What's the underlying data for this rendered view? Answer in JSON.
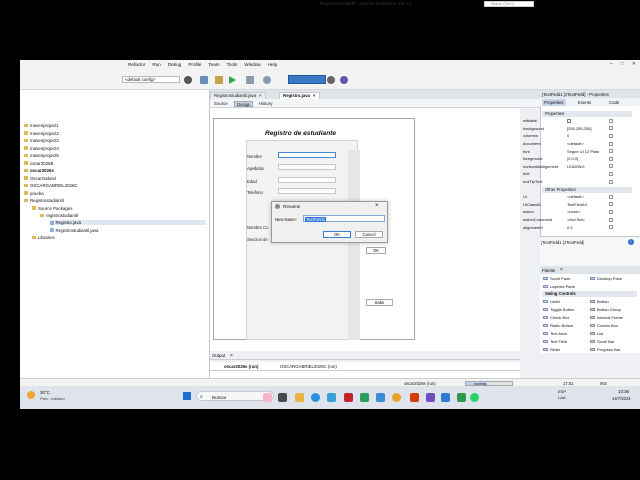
{
  "menu": {
    "items": [
      "Refactor",
      "Run",
      "Debug",
      "Profile",
      "Team",
      "Tools",
      "Window",
      "Help"
    ]
  },
  "window": {
    "title": "Registrostudiantil - Apache NetBeans IDE 23",
    "search_placeholder": "Search (Ctrl+I)",
    "controls": [
      "–",
      "□",
      "✕"
    ]
  },
  "toolbar": {
    "config": "<default config>"
  },
  "tree": {
    "items": [
      {
        "label": "mavenproject1",
        "bold": false
      },
      {
        "label": "mavenproject2",
        "bold": false
      },
      {
        "label": "mavenproject3",
        "bold": false
      },
      {
        "label": "mavenproject4",
        "bold": false
      },
      {
        "label": "mavenproject5",
        "bold": false
      },
      {
        "label": "oscar2026B",
        "bold": false
      },
      {
        "label": "oscar2026s",
        "bold": true
      },
      {
        "label": "OscarGabriel",
        "bold": false
      },
      {
        "label": "OSCARGABRIEL2026C",
        "bold": false
      },
      {
        "label": "prueba",
        "bold": false
      },
      {
        "label": "Registrostudiantil",
        "bold": false
      },
      {
        "label": "Source Packages",
        "bold": false
      },
      {
        "label": "registrostudiantil",
        "bold": false
      },
      {
        "label": "Registro.java",
        "bold": false
      },
      {
        "label": "Registrostudiantil.java",
        "bold": false
      },
      {
        "label": "Libraries",
        "bold": false
      }
    ]
  },
  "editor": {
    "tabs": [
      {
        "label": "Registrostudiantil.java"
      },
      {
        "label": "Registro.java"
      }
    ],
    "subtabs": [
      "Source",
      "Design",
      "History"
    ]
  },
  "form": {
    "title": "Registro de estudiante",
    "labels": [
      "Nombre",
      "Apellidos",
      "Edad",
      "Telefono",
      "Nombre Co",
      "Seccion de"
    ],
    "ok_button": "OK",
    "save_button": "Sabe"
  },
  "dialog": {
    "title": "Rename",
    "field_label": "New Name:",
    "value": "TextField1",
    "ok": "OK",
    "cancel": "Cancel"
  },
  "output": {
    "title": "Output",
    "tabs": [
      "oscar2026s (run)",
      "OSCARGABRIEL2026C (run)"
    ]
  },
  "properties": {
    "header": "jTextField1 [JTextField] - Properties",
    "tabs": [
      "Properties",
      "Events",
      "Code"
    ],
    "section1": "Properties",
    "rows1": [
      {
        "name": "editable",
        "value": "",
        "check": true
      },
      {
        "name": "background",
        "value": "[255,255,255]"
      },
      {
        "name": "columns",
        "value": "0"
      },
      {
        "name": "document",
        "value": "<default>"
      },
      {
        "name": "font",
        "value": "Segoe UI 12 Plain"
      },
      {
        "name": "foreground",
        "value": "[0,0,0]"
      },
      {
        "name": "horizontalAlignment",
        "value": "LEADING"
      },
      {
        "name": "text",
        "value": ""
      },
      {
        "name": "toolTipText",
        "value": ""
      }
    ],
    "section2": "Other Properties",
    "rows2": [
      {
        "name": "UI",
        "value": "<default>"
      },
      {
        "name": "UIClassID",
        "value": "TextFieldUI"
      },
      {
        "name": "action",
        "value": "<none>"
      },
      {
        "name": "actionCommand",
        "value": "<Not Set>"
      },
      {
        "name": "alignmentX",
        "value": "0.5"
      }
    ],
    "description": "jTextField1 [JTextField]"
  },
  "palette": {
    "header": "Palette",
    "items_top": [
      "Scroll Pane",
      "Desktop Pane",
      "Layered Pane"
    ],
    "section": "Swing Controls",
    "items": [
      "Label",
      "Button",
      "Toggle Button",
      "Button Group",
      "Check Box",
      "Internal Frame",
      "Radio Button",
      "Combo Box",
      "Text Area",
      "List",
      "Text Field",
      "Scroll Bar",
      "Slider",
      "Progress Bar"
    ]
  },
  "status": {
    "run": "oscar2026s (run)",
    "state": "running...",
    "position": "17:51",
    "mode": "INS"
  },
  "taskbar": {
    "weather_temp": "30°C",
    "weather_desc": "Parc. nublado",
    "search": "Buscar",
    "lang1": "ESP",
    "lang2": "LAA",
    "time": "10:36",
    "date": "14/7/2024"
  }
}
